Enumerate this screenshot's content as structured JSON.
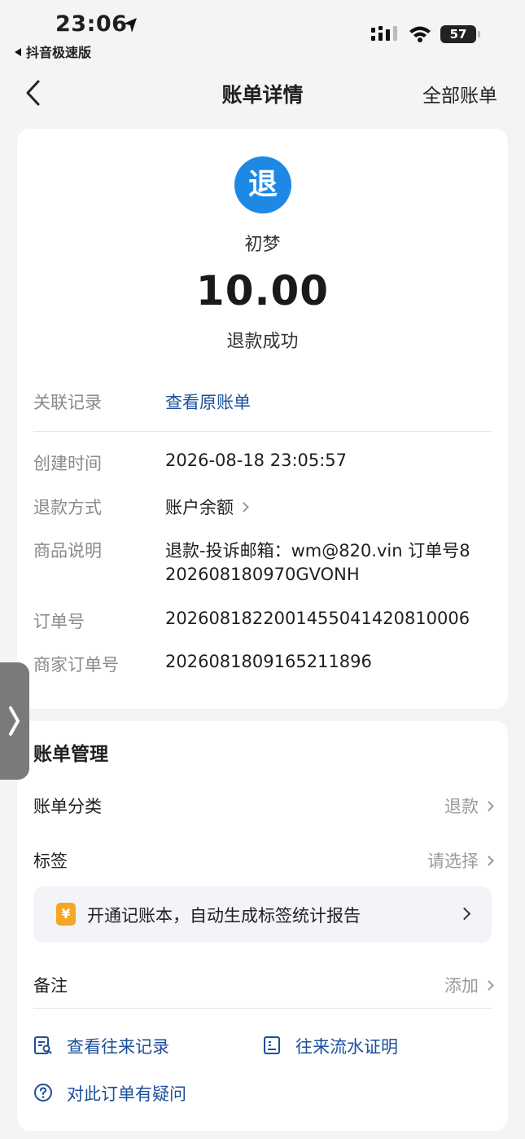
{
  "status_bar": {
    "time": "23:06",
    "back_app": "抖音极速版",
    "battery": "57"
  },
  "nav": {
    "title": "账单详情",
    "all_bills": "全部账单"
  },
  "summary": {
    "icon_char": "退",
    "payee": "初梦",
    "amount": "10.00",
    "status": "退款成功"
  },
  "details": {
    "related_label": "关联记录",
    "related_value": "查看原账单",
    "rows": [
      {
        "label": "创建时间",
        "value": "2026-08-18 23:05:57"
      },
      {
        "label": "退款方式",
        "value": "账户余额"
      },
      {
        "label": "商品说明",
        "value_line1": "退款-投诉邮箱：wm@820.vin 订单号8",
        "value_line2": "202608180970GVONH"
      },
      {
        "label": "订单号",
        "value": "2026081822001455041420810006"
      },
      {
        "label": "商家订单号",
        "value": "2026081809165211896"
      }
    ]
  },
  "management": {
    "title": "账单管理",
    "category_label": "账单分类",
    "category_value": "退款",
    "tag_label": "标签",
    "tag_value": "请选择",
    "promo_icon": "¥",
    "promo_text": "开通记账本，自动生成标签统计报告",
    "note_label": "备注",
    "note_value": "添加",
    "actions": {
      "history": "查看往来记录",
      "proof": "往来流水证明",
      "question": "对此订单有疑问"
    }
  },
  "colors": {
    "accent_link": "#1c4f9c",
    "refund_icon_bg": "#1e88e5",
    "promo_icon_bg": "#f5a623",
    "page_bg": "#f3f4f6"
  },
  "icons": [
    "location-arrow-icon",
    "signal-icon",
    "wifi-icon",
    "battery-icon",
    "back-chevron-icon",
    "refund-icon",
    "chevron-right-icon",
    "ledger-yuan-icon",
    "records-search-icon",
    "proof-doc-icon",
    "question-circle-icon",
    "side-handle-chevron-icon"
  ]
}
